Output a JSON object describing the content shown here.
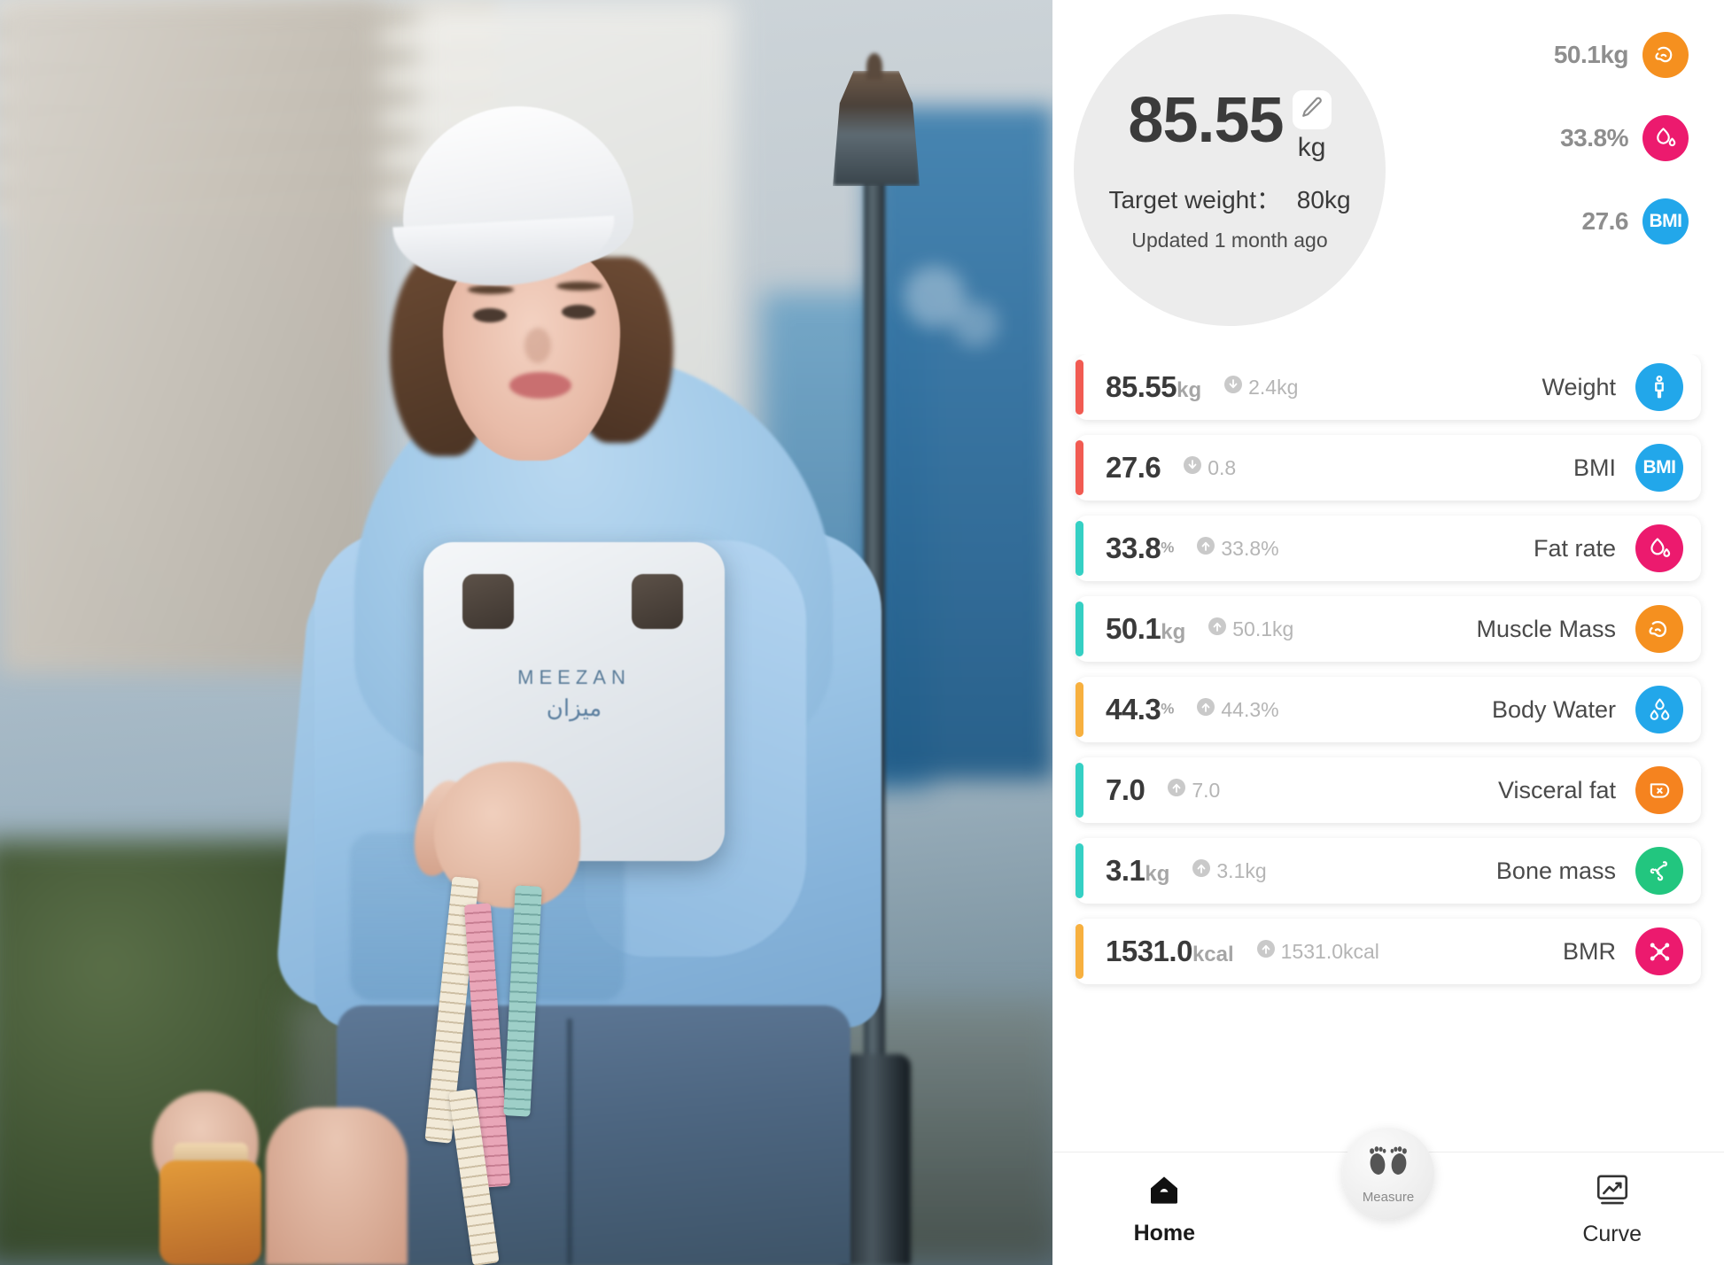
{
  "photo": {
    "scale_brand": "MEEZAN",
    "scale_brand_arabic": "ميزان"
  },
  "hero": {
    "weight_value": "85.55",
    "unit": "kg",
    "target_label": "Target weight：",
    "target_value": "80kg",
    "updated": "Updated 1 month ago",
    "edit_icon": "pencil-icon",
    "badges": [
      {
        "value": "50.1kg",
        "icon": "muscle-icon",
        "color": "#f5901f"
      },
      {
        "value": "33.8%",
        "icon": "fat-drop-icon",
        "color": "#ec1a6e"
      },
      {
        "value": "27.6",
        "icon": "bmi-icon",
        "color": "#22a7ea",
        "text": "BMI"
      }
    ]
  },
  "metrics": [
    {
      "value": "85.55",
      "unit": "kg",
      "unit_sup": false,
      "delta": "2.4kg",
      "direction": "down",
      "label": "Weight",
      "icon": "person-icon",
      "icon_color": "#22a7ea",
      "accent": "#f15b52"
    },
    {
      "value": "27.6",
      "unit": "",
      "unit_sup": false,
      "delta": "0.8",
      "direction": "down",
      "label": "BMI",
      "icon": "bmi-icon",
      "icon_color": "#22a7ea",
      "accent": "#f15b52",
      "icon_text": "BMI"
    },
    {
      "value": "33.8",
      "unit": "%",
      "unit_sup": true,
      "delta": "33.8%",
      "direction": "up",
      "label": "Fat rate",
      "icon": "fat-drop-icon",
      "icon_color": "#ec1a6e",
      "accent": "#35d0c4"
    },
    {
      "value": "50.1",
      "unit": "kg",
      "unit_sup": false,
      "delta": "50.1kg",
      "direction": "up",
      "label": "Muscle Mass",
      "icon": "muscle-icon",
      "icon_color": "#f5901f",
      "accent": "#35cfc3"
    },
    {
      "value": "44.3",
      "unit": "%",
      "unit_sup": true,
      "delta": "44.3%",
      "direction": "up",
      "label": "Body Water",
      "icon": "water-drops-icon",
      "icon_color": "#22a7ea",
      "accent": "#f7b03f"
    },
    {
      "value": "7.0",
      "unit": "",
      "unit_sup": false,
      "delta": "7.0",
      "direction": "up",
      "label": "Visceral fat",
      "icon": "visceral-organ-icon",
      "icon_color": "#f5831f",
      "accent": "#35d0c4"
    },
    {
      "value": "3.1",
      "unit": "kg",
      "unit_sup": false,
      "delta": "3.1kg",
      "direction": "up",
      "label": "Bone mass",
      "icon": "bone-skeleton-icon",
      "icon_color": "#22c67f",
      "accent": "#35d0c4"
    },
    {
      "value": "1531.0",
      "unit": "kcal",
      "unit_sup": false,
      "delta": "1531.0kcal",
      "direction": "up",
      "label": "BMR",
      "icon": "metabolism-molecule-icon",
      "icon_color": "#ec1a6e",
      "accent": "#f7b03f"
    }
  ],
  "bottom_nav": {
    "home": {
      "label": "Home",
      "icon": "home-icon"
    },
    "measure": {
      "label": "Measure",
      "icon": "footprints-icon"
    },
    "curve": {
      "label": "Curve",
      "icon": "trend-chart-icon"
    }
  }
}
